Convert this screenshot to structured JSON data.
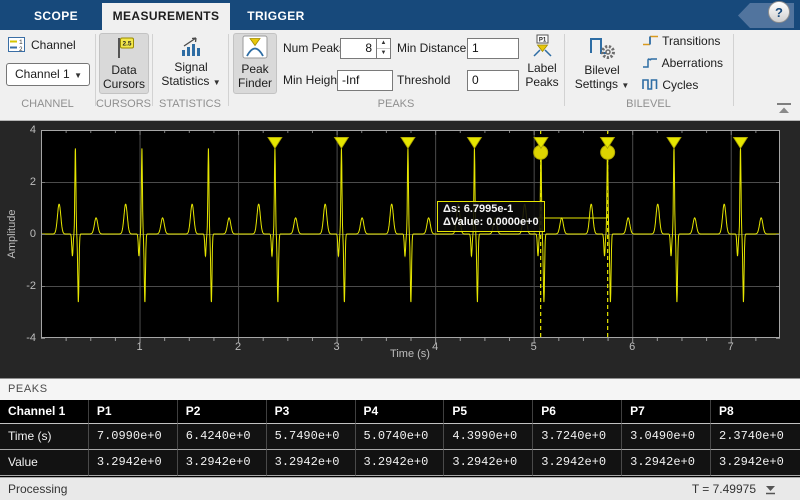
{
  "tabs": [
    {
      "label": "SCOPE",
      "active": false
    },
    {
      "label": "MEASUREMENTS",
      "active": true
    },
    {
      "label": "TRIGGER",
      "active": false
    }
  ],
  "help": {
    "label": "?"
  },
  "toolbar": {
    "channel": {
      "group_label": "CHANNEL",
      "button_label": "Channel",
      "dropdown_value": "Channel 1"
    },
    "cursors": {
      "group_label": "CURSORS",
      "button_line1": "Data",
      "button_line2": "Cursors",
      "cursor_tag": "2.5"
    },
    "statistics": {
      "group_label": "STATISTICS",
      "button_line1": "Signal",
      "button_line2": "Statistics"
    },
    "peaks": {
      "group_label": "PEAKS",
      "peak_finder_line1": "Peak",
      "peak_finder_line2": "Finder",
      "num_peaks_label": "Num Peaks",
      "num_peaks_value": "8",
      "min_height_label": "Min Height",
      "min_height_value": "-Inf",
      "min_distance_label": "Min Distance",
      "min_distance_value": "1",
      "threshold_label": "Threshold",
      "threshold_value": "0",
      "label_peaks_line1": "Label",
      "label_peaks_line2": "Peaks",
      "label_peaks_icon_tag": "P1"
    },
    "bilevel": {
      "group_label": "BILEVEL",
      "settings_line1": "Bilevel",
      "settings_line2": "Settings",
      "buttons": [
        "Transitions",
        "Aberrations",
        "Cycles"
      ]
    }
  },
  "chart_data": {
    "type": "line",
    "title": "",
    "xlabel": "Time (s)",
    "ylabel": "Amplitude",
    "xlim": [
      0,
      7.5
    ],
    "ylim": [
      -4,
      4
    ],
    "xticks": [
      1,
      2,
      3,
      4,
      5,
      6,
      7
    ],
    "yticks": [
      4,
      2,
      0,
      -2,
      -4
    ],
    "grid": true,
    "background": "#000000",
    "grid_color": "#4b4b4b",
    "series": [
      {
        "name": "Channel 1",
        "color": "#e6e600",
        "waveform": "synthetic ECG",
        "first_r_time": 0.349,
        "beat_period": 0.675,
        "r_amplitude": 3.2942,
        "p_amplitude": 1.15,
        "q_amplitude": -0.85,
        "s_amplitude": -2.62,
        "t_amplitude": 0.62
      }
    ],
    "peak_markers": {
      "times": [
        2.374,
        3.049,
        3.724,
        4.399,
        5.074,
        5.749,
        6.424,
        7.099
      ],
      "value": 3.2942
    },
    "cursors": {
      "times": [
        5.071,
        5.751
      ]
    }
  },
  "cursor_tooltip": {
    "line1": "Δs: 6.7995e-1",
    "line2": "ΔValue: 0.0000e+0"
  },
  "peaks_panel": {
    "title": "PEAKS",
    "table": {
      "corner": "Channel 1",
      "columns": [
        "P1",
        "P2",
        "P3",
        "P4",
        "P5",
        "P6",
        "P7",
        "P8"
      ],
      "rows": [
        {
          "label": "Time (s)",
          "values": [
            "7.0990e+0",
            "6.4240e+0",
            "5.7490e+0",
            "5.0740e+0",
            "4.3990e+0",
            "3.7240e+0",
            "3.0490e+0",
            "2.3740e+0"
          ]
        },
        {
          "label": "Value",
          "values": [
            "3.2942e+0",
            "3.2942e+0",
            "3.2942e+0",
            "3.2942e+0",
            "3.2942e+0",
            "3.2942e+0",
            "3.2942e+0",
            "3.2942e+0"
          ]
        }
      ]
    }
  },
  "status_bar": {
    "left": "Processing",
    "right": "T = 7.49975"
  }
}
